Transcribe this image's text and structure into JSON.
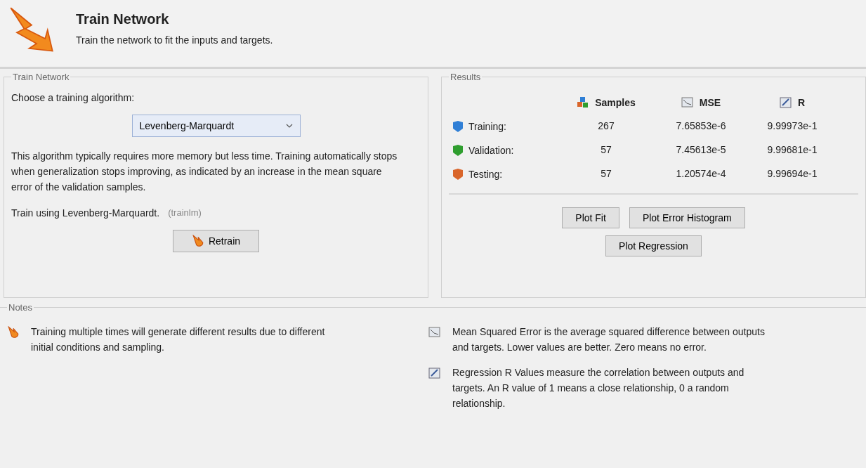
{
  "header": {
    "title": "Train Network",
    "subtitle": "Train the network to fit the inputs and targets."
  },
  "train_panel": {
    "title": "Train Network",
    "prompt": "Choose a training algorithm:",
    "algorithm": "Levenberg-Marquardt",
    "description": "This algorithm typically requires more memory but less time. Training automatically stops when generalization stops improving, as indicated by an increase in the mean square error of the validation samples.",
    "train_using": "Train using Levenberg-Marquardt.",
    "function_name": "(trainlm)",
    "retrain_button": "Retrain"
  },
  "results": {
    "title": "Results",
    "columns": [
      {
        "label": "Samples",
        "kind": "samples"
      },
      {
        "label": "MSE",
        "kind": "mse"
      },
      {
        "label": "R",
        "kind": "r"
      }
    ],
    "rows": [
      {
        "label": "Training:",
        "color": "#2f7fd6",
        "samples": "267",
        "mse": "7.65853e-6",
        "r": "9.99973e-1"
      },
      {
        "label": "Validation:",
        "color": "#2f9e2f",
        "samples": "57",
        "mse": "7.45613e-5",
        "r": "9.99681e-1"
      },
      {
        "label": "Testing:",
        "color": "#d9652a",
        "samples": "57",
        "mse": "1.20574e-4",
        "r": "9.99694e-1"
      }
    ],
    "buttons": [
      "Plot Fit",
      "Plot Error Histogram",
      "Plot Regression"
    ]
  },
  "notes": {
    "title": "Notes",
    "items": [
      {
        "kind": "train",
        "text": "Training multiple times will generate different results due to different initial conditions and sampling."
      },
      {
        "kind": "mse",
        "text": "Mean Squared Error is the average squared difference between outputs and targets. Lower values are better. Zero means no error."
      },
      {
        "kind": "r",
        "text": "Regression R Values measure the correlation between outputs and targets. An R value of 1 means a close relationship, 0 a random relationship."
      }
    ]
  }
}
